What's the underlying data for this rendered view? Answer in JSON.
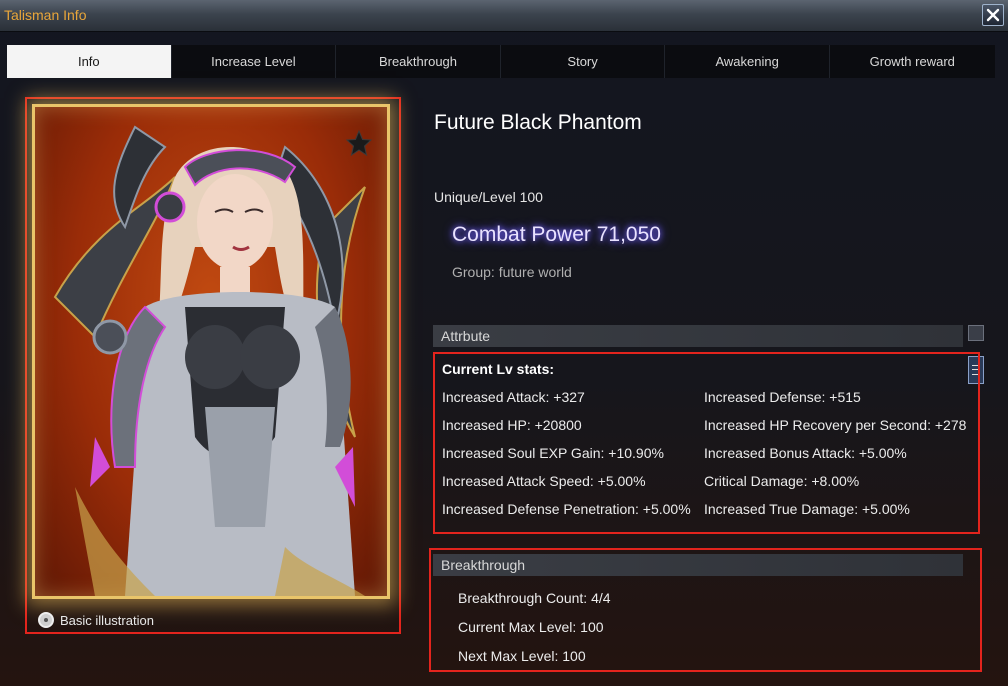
{
  "window": {
    "title": "Talisman Info"
  },
  "tabs": [
    {
      "label": "Info",
      "active": true
    },
    {
      "label": "Increase Level",
      "active": false
    },
    {
      "label": "Breakthrough",
      "active": false
    },
    {
      "label": "Story",
      "active": false
    },
    {
      "label": "Awakening",
      "active": false
    },
    {
      "label": "Growth reward",
      "active": false
    }
  ],
  "card": {
    "illustration_label": "Basic illustration",
    "icons": [
      "star-icon",
      "radio-icon"
    ]
  },
  "character": {
    "name": "Future Black Phantom",
    "rarity_level": "Unique/Level 100",
    "combat_power": "Combat Power 71,050",
    "group": "Group: future world"
  },
  "attribute": {
    "header": "Attrbute",
    "stats_title": "Current Lv stats:",
    "left": [
      "Increased Attack: +327",
      "Increased HP: +20800",
      "Increased Soul EXP Gain: +10.90%",
      "Increased Attack Speed: +5.00%",
      "Increased Defense Penetration: +5.00%"
    ],
    "right": [
      "Increased Defense: +515",
      "Increased HP Recovery per Second: +278",
      "Increased Bonus Attack: +5.00%",
      "Critical Damage: +8.00%",
      "Increased True Damage: +5.00%"
    ]
  },
  "breakthrough": {
    "header": "Breakthrough",
    "count": "Breakthrough Count: 4/4",
    "current_max": "Current Max Level: 100",
    "next_max": "Next Max Level: 100"
  },
  "colors": {
    "accent": "#e9a63a",
    "highlight_border": "#e3241d",
    "power_glow": "#7a6bff"
  }
}
